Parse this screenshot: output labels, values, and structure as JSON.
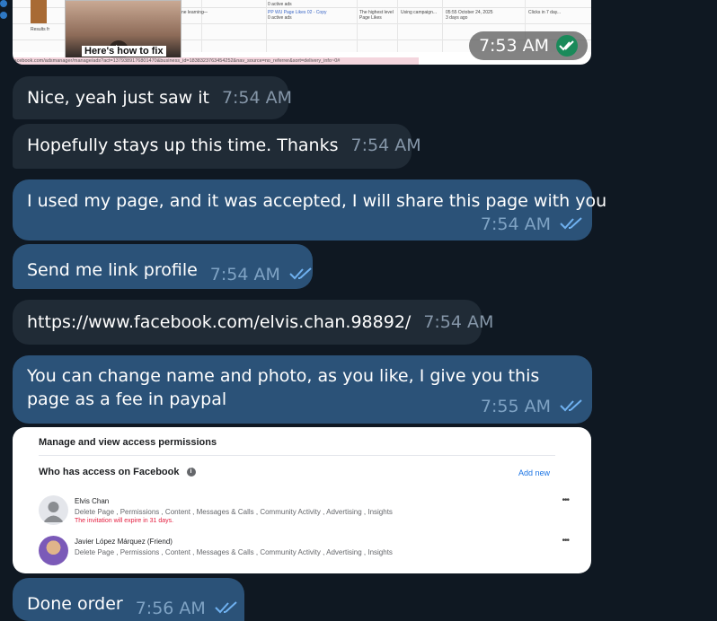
{
  "top_screenshot": {
    "video_caption": "Here's how to fix",
    "url": "facebook.com/adsmanager/manage/ads?act=1379389176801470&business_id=1838323763454252&nav_source=no_referrer&sort=delivery_info~0#",
    "cells": {
      "learning": "ne learning",
      "dash": "—",
      "ad_name": "PP WU Page Likes 02 - Copy",
      "active_ads": "0 active ads",
      "highest": "The highest level",
      "campaign": "Using campaign...",
      "date": "05:55 October 24, 2025",
      "days_ago": "3 days ago",
      "clicks": "Clicks in 7 day...",
      "page_likes": "Page Likes",
      "results": "Results fr"
    },
    "time": "7:53 AM"
  },
  "messages": [
    {
      "id": "m1",
      "side": "in",
      "text": "Nice, yeah just saw it",
      "time": "7:54 AM"
    },
    {
      "id": "m2",
      "side": "in",
      "text": "Hopefully stays up this time. Thanks",
      "time": "7:54 AM"
    },
    {
      "id": "m3",
      "side": "out",
      "text": "I used my page, and it was accepted, I will share this page with you",
      "time": "7:54 AM"
    },
    {
      "id": "m4",
      "side": "out",
      "text": "Send me link profile",
      "time": "7:54 AM"
    },
    {
      "id": "m5",
      "side": "in",
      "text": "https://www.facebook.com/elvis.chan.98892/",
      "time": "7:54 AM"
    },
    {
      "id": "m6",
      "side": "out",
      "text": "You can change name and photo, as you like, I give you this page as a fee in paypal",
      "time": "7:55 AM"
    },
    {
      "id": "m7",
      "side": "out",
      "text": "Done order",
      "time": "7:56 AM"
    }
  ],
  "permissions": {
    "title": "Manage and view access permissions",
    "section": "Who has access on Facebook",
    "add_new": "Add new",
    "people": [
      {
        "name": "Elvis Chan",
        "roles": "Delete Page , Permissions , Content , Messages & Calls , Community Activity , Advertising , Insights",
        "warning": "The invitation will expire in 31 days."
      },
      {
        "name": "Javier López Márquez (Friend)",
        "roles": "Delete Page , Permissions , Content , Messages & Calls , Community Activity , Advertising , Insights"
      }
    ],
    "more": "•••"
  },
  "colors": {
    "background": "#0f1822",
    "incoming": "#202b36",
    "outgoing": "#2b5278",
    "tick": "#6fb1f0"
  }
}
